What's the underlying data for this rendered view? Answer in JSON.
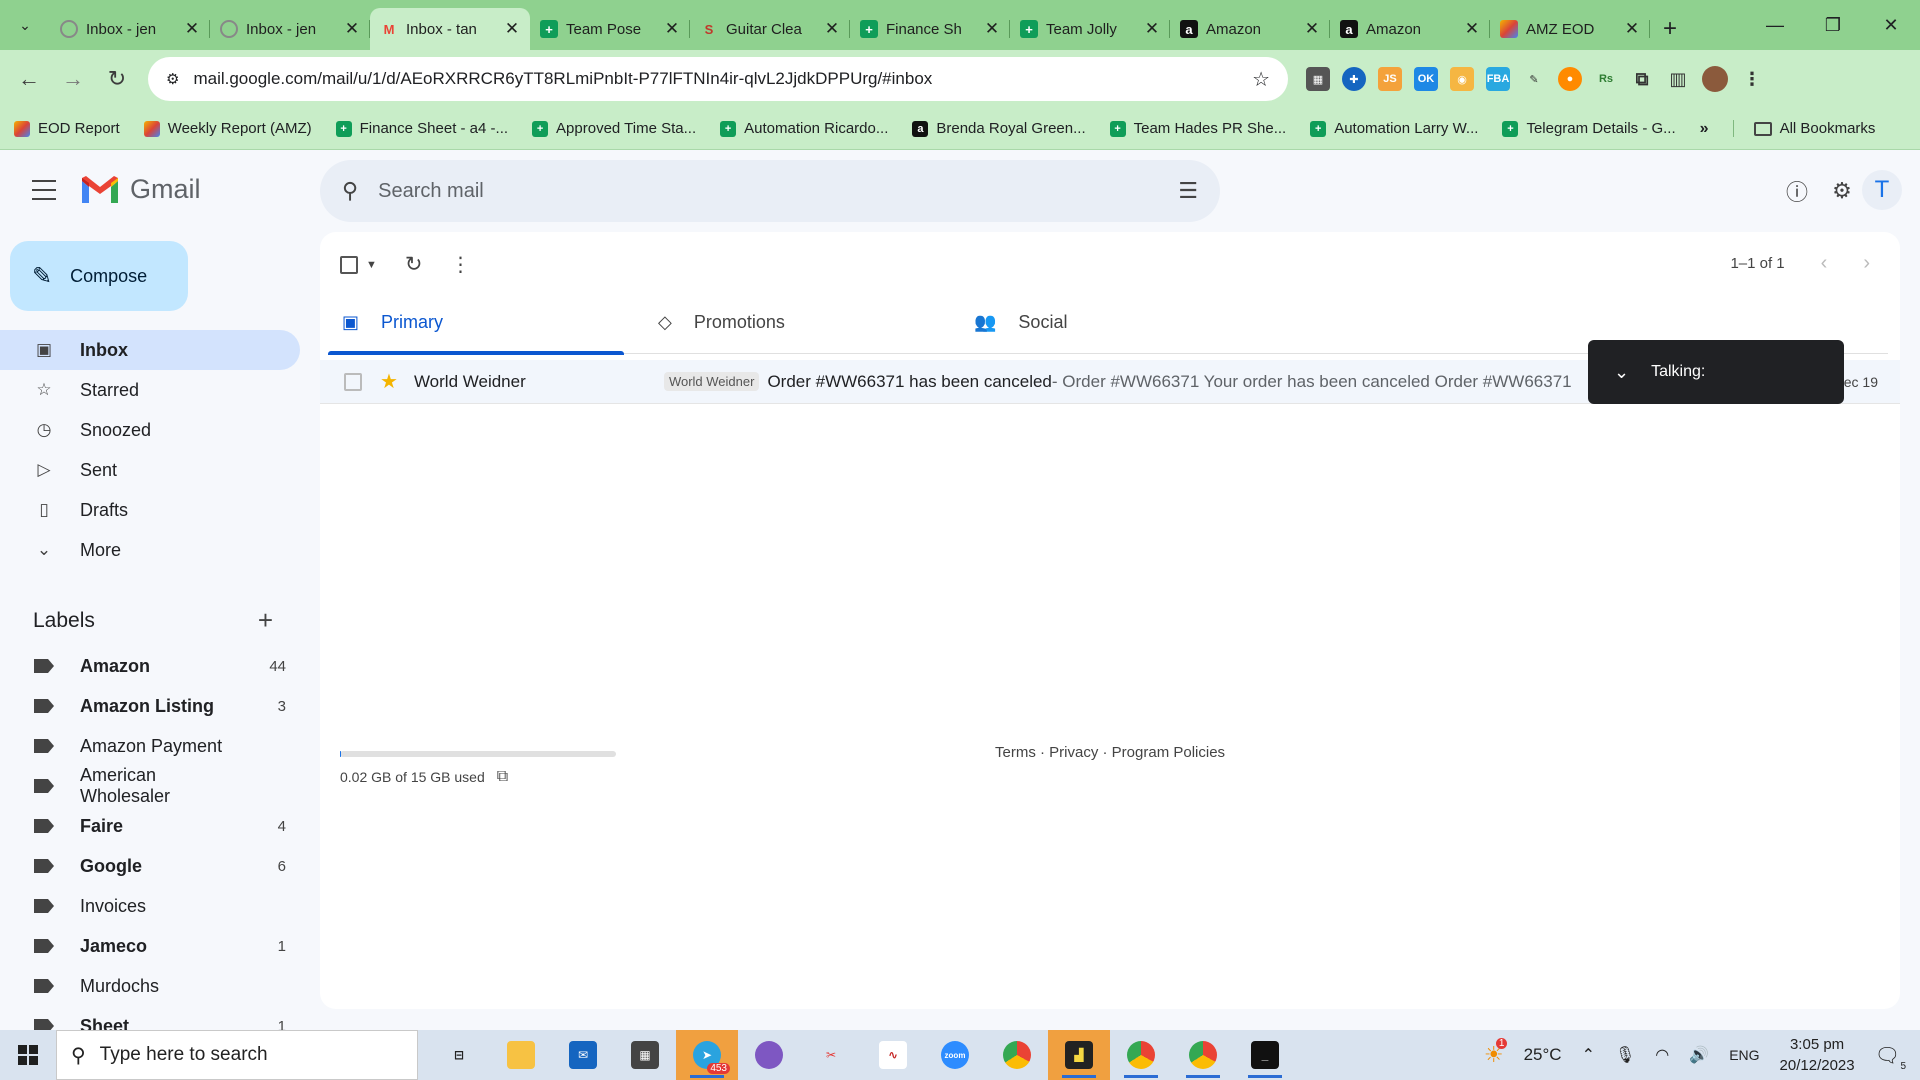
{
  "browser": {
    "tabs": [
      {
        "title": "Inbox - jen",
        "icon": "gmail-icon"
      },
      {
        "title": "Inbox - jen",
        "icon": "gmail-icon"
      },
      {
        "title": "Inbox - tan",
        "icon": "gmail-icon"
      },
      {
        "title": "Team Pose",
        "icon": "sheets-icon"
      },
      {
        "title": "Guitar Clea",
        "icon": "guitar-icon"
      },
      {
        "title": "Finance Sh",
        "icon": "sheets-icon"
      },
      {
        "title": "Team Jolly",
        "icon": "sheets-icon"
      },
      {
        "title": "Amazon",
        "icon": "amazon-icon"
      },
      {
        "title": "Amazon",
        "icon": "amazon-icon"
      },
      {
        "title": "AMZ EOD",
        "icon": "eod-icon"
      }
    ],
    "active_tab": 2,
    "url": "mail.google.com/mail/u/1/d/AEoRXRRCR6yTT8RLmiPnbIt-P77lFTNIn4ir-qlvL2JjdkDPPUrg/#inbox",
    "bookmarks": [
      {
        "label": "EOD Report",
        "icon": "eod-icon"
      },
      {
        "label": "Weekly Report (AMZ)",
        "icon": "eod-icon"
      },
      {
        "label": "Finance Sheet - a4 -...",
        "icon": "sheets-icon"
      },
      {
        "label": "Approved Time Sta...",
        "icon": "sheets-icon"
      },
      {
        "label": "Automation Ricardo...",
        "icon": "sheets-icon"
      },
      {
        "label": "Brenda Royal Green...",
        "icon": "amazon-icon"
      },
      {
        "label": "Team Hades PR She...",
        "icon": "sheets-icon"
      },
      {
        "label": "Automation Larry W...",
        "icon": "sheets-icon"
      },
      {
        "label": "Telegram Details - G...",
        "icon": "sheets-icon"
      }
    ],
    "all_bookmarks": "All Bookmarks"
  },
  "gmail": {
    "logo_text": "Gmail",
    "search_placeholder": "Search mail",
    "account_initial": "T",
    "compose_label": "Compose",
    "nav": [
      {
        "label": "Inbox",
        "icon": "inbox-icon",
        "active": true
      },
      {
        "label": "Starred",
        "icon": "star-icon"
      },
      {
        "label": "Snoozed",
        "icon": "clock-icon"
      },
      {
        "label": "Sent",
        "icon": "send-icon"
      },
      {
        "label": "Drafts",
        "icon": "draft-icon"
      },
      {
        "label": "More",
        "icon": "chevron-down-icon"
      }
    ],
    "labels_title": "Labels",
    "labels": [
      {
        "name": "Amazon",
        "count": "44",
        "bold": true
      },
      {
        "name": "Amazon Listing",
        "count": "3",
        "bold": true
      },
      {
        "name": "Amazon Payment",
        "count": "",
        "bold": false
      },
      {
        "name": "American Wholesaler",
        "count": "",
        "bold": false
      },
      {
        "name": "Faire",
        "count": "4",
        "bold": true
      },
      {
        "name": "Google",
        "count": "6",
        "bold": true
      },
      {
        "name": "Invoices",
        "count": "",
        "bold": false
      },
      {
        "name": "Jameco",
        "count": "1",
        "bold": true
      },
      {
        "name": "Murdochs",
        "count": "",
        "bold": false
      },
      {
        "name": "Sheet",
        "count": "1",
        "bold": true
      }
    ],
    "pager_text": "1–1 of 1",
    "tabs": [
      {
        "label": "Primary",
        "icon": "inbox-tab-icon"
      },
      {
        "label": "Promotions",
        "icon": "tag-icon"
      },
      {
        "label": "Social",
        "icon": "people-icon"
      }
    ],
    "emails": [
      {
        "sender": "World Weidner",
        "label_chip": "World Weidner",
        "subject": "Order #WW66371 has been canceled",
        "snippet": " - Order #WW66371 Your order has been canceled Order #WW66371",
        "date": "Dec 19"
      }
    ],
    "storage": "0.02 GB of 15 GB used",
    "storage_fraction": 0.0013,
    "footer_links": "Terms · Privacy · Program Policies",
    "toast_text": "Talking:"
  },
  "taskbar": {
    "search_placeholder": "Type here to search",
    "telegram_badge": "453",
    "weather_badge": "1",
    "temperature": "25°C",
    "language": "ENG",
    "time": "3:05 pm",
    "date": "20/12/2023",
    "notifications": "5"
  }
}
